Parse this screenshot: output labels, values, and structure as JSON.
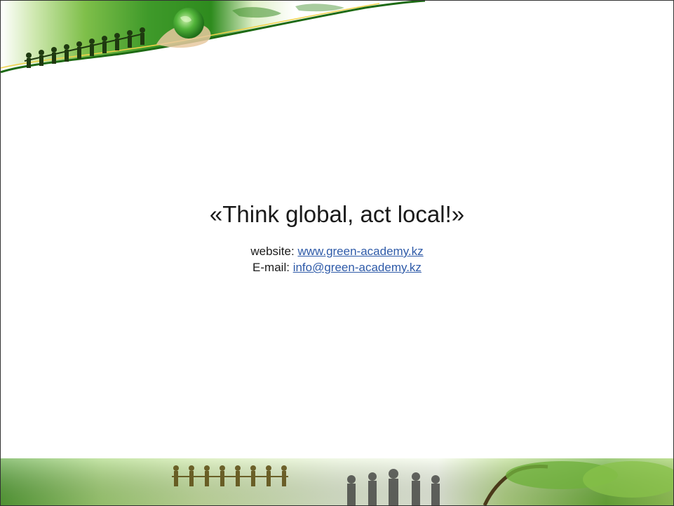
{
  "slide": {
    "title": "«Think global, act local!»",
    "website_label": "website:",
    "website_link": "www.green-academy.kz",
    "email_label": "E-mail:",
    "email_link": "info@green-academy.kz"
  },
  "icons": {
    "header": "globe-in-hands-with-people-chain",
    "footer": "people-chain-business-team-nature"
  },
  "colors": {
    "brand_green": "#2e8b1e",
    "light_green": "#9ed36a",
    "link_blue": "#2e5aa8",
    "text": "#1a1a1a",
    "border": "#333333"
  }
}
